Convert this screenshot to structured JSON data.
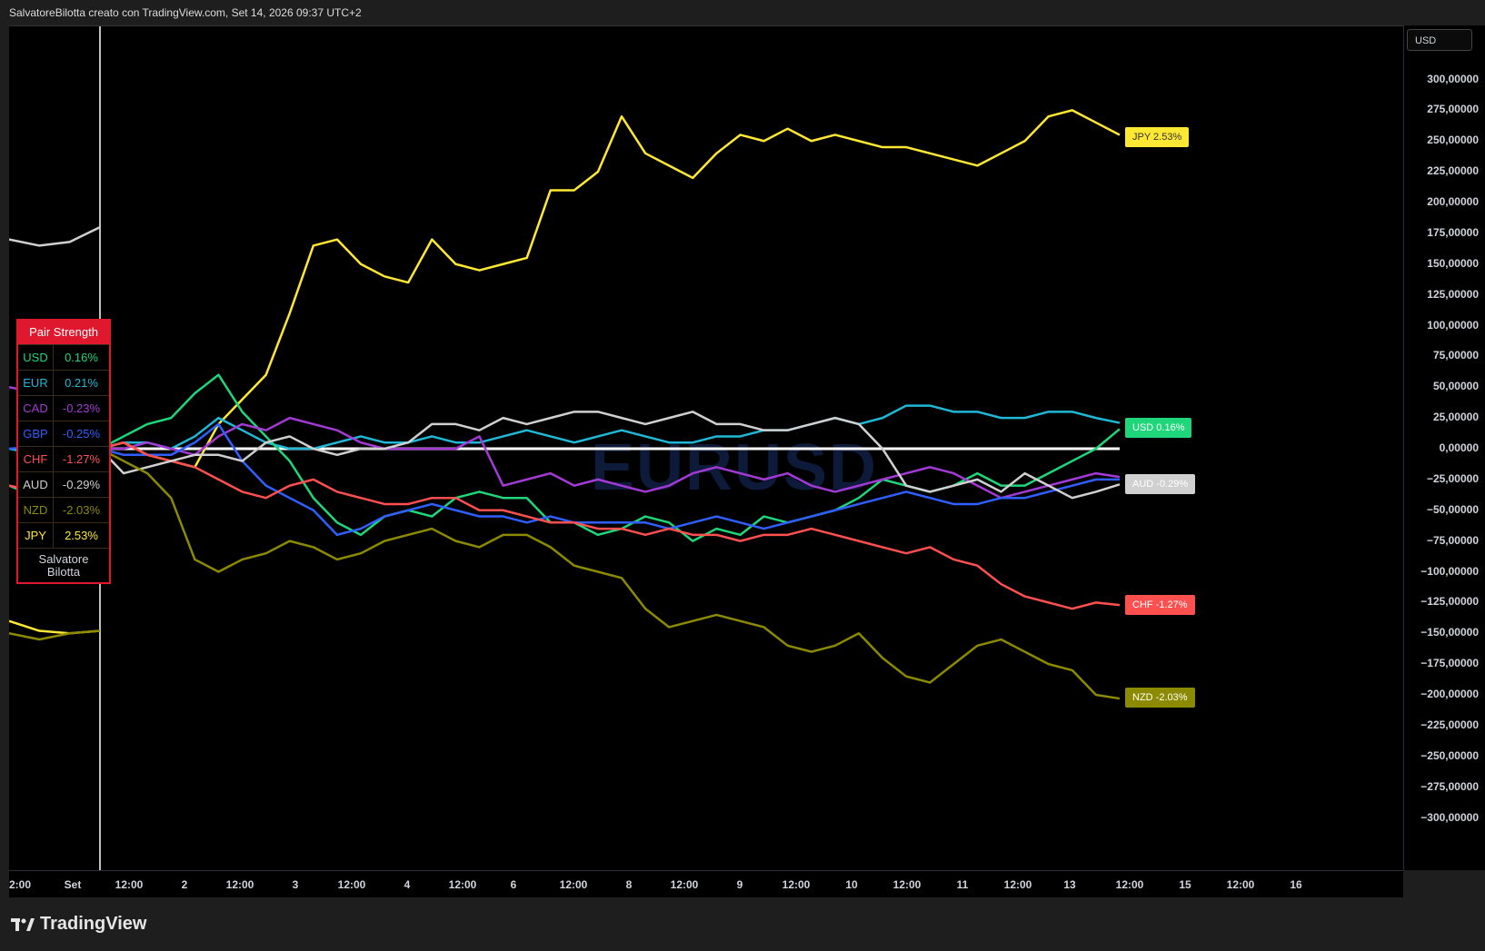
{
  "topbar": {
    "text": "SalvatoreBilotta creato con TradingView.com, Set 14, 2026 09:37 UTC+2"
  },
  "watermark": "EURUSD",
  "yaxis": {
    "currency": "USD",
    "ticks": [
      "300,00000",
      "275,00000",
      "250,00000",
      "225,00000",
      "200,00000",
      "175,00000",
      "150,00000",
      "125,00000",
      "100,00000",
      "75,00000",
      "50,00000",
      "25,00000",
      "0,00000",
      "−25,00000",
      "−50,00000",
      "−75,00000",
      "−100,00000",
      "−125,00000",
      "−150,00000",
      "−175,00000",
      "−200,00000",
      "−225,00000",
      "−250,00000",
      "−275,00000",
      "−300,00000"
    ]
  },
  "xaxis": {
    "ticks": [
      "2:00",
      "Set",
      "12:00",
      "2",
      "12:00",
      "3",
      "12:00",
      "4",
      "12:00",
      "6",
      "12:00",
      "8",
      "12:00",
      "9",
      "12:00",
      "10",
      "12:00",
      "11",
      "12:00",
      "13",
      "12:00",
      "15",
      "12:00",
      "16"
    ]
  },
  "strength_table": {
    "title": "Pair Strength",
    "rows": [
      {
        "cur": "USD",
        "val": "0.16%",
        "color": "#1fd67a"
      },
      {
        "cur": "EUR",
        "val": "0.21%",
        "color": "#1fb8d6"
      },
      {
        "cur": "CAD",
        "val": "-0.23%",
        "color": "#a33ad6"
      },
      {
        "cur": "GBP",
        "val": "-0.25%",
        "color": "#2f5fff"
      },
      {
        "cur": "CHF",
        "val": "-1.27%",
        "color": "#ff5050"
      },
      {
        "cur": "AUD",
        "val": "-0.29%",
        "color": "#d0d0d0"
      },
      {
        "cur": "NZD",
        "val": "-2.03%",
        "color": "#8c8a00"
      },
      {
        "cur": "JPY",
        "val": "2.53%",
        "color": "#ffe833"
      }
    ],
    "footer_line1": "Salvatore",
    "footer_line2": "Bilotta"
  },
  "price_labels": [
    {
      "text": "JPY 2.53%",
      "bg": "#ffe833",
      "fg": "#333333"
    },
    {
      "text": "USD 0.16%",
      "bg": "#1fd67a",
      "fg": "#ffffff"
    },
    {
      "text": "AUD -0.29%",
      "bg": "#d0d0d0",
      "fg": "#ffffff"
    },
    {
      "text": "CHF -1.27%",
      "bg": "#ff5050",
      "fg": "#ffffff"
    },
    {
      "text": "NZD -2.03%",
      "bg": "#8c8a00",
      "fg": "#ffffff"
    }
  ],
  "footer": {
    "brand": "TradingView"
  },
  "chart_data": {
    "type": "line",
    "ylim": [
      -300,
      300
    ],
    "series": [
      {
        "name": "JPY",
        "color": "#ffe833",
        "values": [
          -140,
          -148,
          -150,
          -148,
          0,
          5,
          -5,
          -10,
          -15,
          20,
          40,
          60,
          110,
          165,
          170,
          150,
          140,
          135,
          170,
          150,
          145,
          150,
          155,
          210,
          210,
          225,
          270,
          240,
          230,
          220,
          240,
          255,
          250,
          260,
          250,
          255,
          250,
          245,
          245,
          240,
          235,
          230,
          240,
          250,
          270,
          275,
          265,
          255
        ]
      },
      {
        "name": "EUR",
        "color": "#1fb8d6",
        "values": [
          0,
          -5,
          -6,
          0,
          0,
          5,
          5,
          0,
          10,
          25,
          15,
          5,
          0,
          0,
          5,
          10,
          5,
          5,
          10,
          5,
          5,
          10,
          15,
          10,
          5,
          10,
          15,
          10,
          5,
          5,
          10,
          10,
          15,
          15,
          20,
          25,
          20,
          25,
          35,
          35,
          30,
          30,
          25,
          25,
          30,
          30,
          25,
          21
        ]
      },
      {
        "name": "USD",
        "color": "#1fd67a",
        "values": [
          -30,
          -40,
          -30,
          -20,
          0,
          10,
          20,
          25,
          45,
          60,
          30,
          10,
          -10,
          -40,
          -60,
          -70,
          -55,
          -50,
          -55,
          -40,
          -35,
          -40,
          -40,
          -60,
          -60,
          -70,
          -65,
          -55,
          -60,
          -75,
          -65,
          -70,
          -55,
          -60,
          -55,
          -50,
          -40,
          -25,
          -30,
          -35,
          -30,
          -20,
          -30,
          -30,
          -20,
          -10,
          0,
          16
        ]
      },
      {
        "name": "CAD",
        "color": "#a33ad6",
        "values": [
          50,
          45,
          40,
          45,
          0,
          0,
          5,
          0,
          -5,
          10,
          20,
          15,
          25,
          20,
          15,
          5,
          0,
          0,
          0,
          0,
          10,
          -30,
          -25,
          -20,
          -30,
          -25,
          -30,
          -35,
          -30,
          -20,
          -15,
          -20,
          -25,
          -20,
          -30,
          -35,
          -30,
          -25,
          -20,
          -15,
          -20,
          -30,
          -40,
          -35,
          -30,
          -25,
          -20,
          -23
        ]
      },
      {
        "name": "GBP",
        "color": "#2f5fff",
        "values": [
          0,
          2,
          3,
          0,
          0,
          -5,
          -5,
          -5,
          5,
          20,
          -10,
          -30,
          -40,
          -50,
          -70,
          -65,
          -55,
          -50,
          -45,
          -50,
          -55,
          -55,
          -60,
          -55,
          -60,
          -60,
          -60,
          -60,
          -65,
          -60,
          -55,
          -60,
          -65,
          -60,
          -55,
          -50,
          -45,
          -40,
          -35,
          -40,
          -45,
          -45,
          -40,
          -40,
          -35,
          -30,
          -25,
          -25
        ]
      },
      {
        "name": "CHF",
        "color": "#ff5050",
        "values": [
          -30,
          -35,
          -25,
          -20,
          0,
          5,
          -5,
          -10,
          -15,
          -25,
          -35,
          -40,
          -30,
          -25,
          -35,
          -40,
          -45,
          -45,
          -40,
          -40,
          -50,
          -50,
          -55,
          -60,
          -60,
          -65,
          -65,
          -70,
          -65,
          -70,
          -70,
          -75,
          -70,
          -70,
          -65,
          -70,
          -75,
          -80,
          -85,
          -80,
          -90,
          -95,
          -110,
          -120,
          -125,
          -130,
          -125,
          -127
        ]
      },
      {
        "name": "AUD",
        "color": "#d0d0d0",
        "values": [
          170,
          165,
          168,
          180,
          0,
          -20,
          -15,
          -10,
          -5,
          -5,
          -10,
          5,
          10,
          0,
          -5,
          0,
          0,
          5,
          20,
          20,
          15,
          25,
          20,
          25,
          30,
          30,
          25,
          20,
          25,
          30,
          20,
          20,
          15,
          15,
          20,
          25,
          20,
          0,
          -30,
          -35,
          -30,
          -25,
          -35,
          -20,
          -30,
          -40,
          -35,
          -29
        ]
      },
      {
        "name": "NZD",
        "color": "#8c8a00",
        "values": [
          -150,
          -155,
          -150,
          -148,
          0,
          -10,
          -20,
          -40,
          -90,
          -100,
          -90,
          -85,
          -75,
          -80,
          -90,
          -85,
          -75,
          -70,
          -65,
          -75,
          -80,
          -70,
          -70,
          -80,
          -95,
          -100,
          -105,
          -130,
          -145,
          -140,
          -135,
          -140,
          -145,
          -160,
          -165,
          -160,
          -150,
          -170,
          -185,
          -190,
          -175,
          -160,
          -155,
          -165,
          -175,
          -180,
          -200,
          -203
        ]
      }
    ]
  }
}
